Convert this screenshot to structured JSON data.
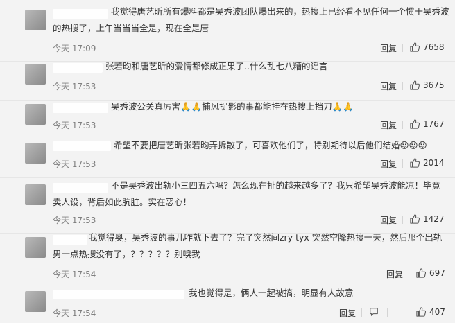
{
  "comments": [
    {
      "text": "我觉得唐艺昕所有爆料都是吴秀波团队爆出来的，热搜上已经看不见任何一个惯于吴秀波的热搜了，上午当当当全是，现在全是唐",
      "time": "今天 17:09",
      "reply": "回复",
      "likes": "7658"
    },
    {
      "text": "张若昀和唐艺昕的爱情都修成正果了..什么乱七八糟的谣言",
      "time": "今天 17:53",
      "reply": "回复",
      "likes": "3675"
    },
    {
      "text": "吴秀波公关真厉害🙏🙏捕风捉影的事都能挂在热搜上挡刀🙏🙏",
      "time": "今天 17:53",
      "reply": "回复",
      "likes": "1767"
    },
    {
      "text": "希望不要把唐艺昕张若昀弄拆散了，可喜欢他们了，特别期待以后他们结婚😟😟😟",
      "time": "今天 17:53",
      "reply": "回复",
      "likes": "2014"
    },
    {
      "text": "不是吴秀波出轨小三四五六吗？怎么现在扯的越来越多了？我只希望吴秀波能凉！毕竟卖人设，背后如此肮脏。实在恶心！",
      "time": "今天 17:53",
      "reply": "回复",
      "likes": "1427"
    },
    {
      "text": "我觉得奥，吴秀波的事儿咋就下去了？完了突然间zry tyx 突然空降热搜一天，然后那个出轨男一点热搜没有了，？？？？？别嗅我",
      "time": "今天 17:54",
      "reply": "回复",
      "likes": "697"
    },
    {
      "text": "我也觉得是，俩人一起被搞，明显有人故意",
      "time": "今天 17:54",
      "reply": "回复",
      "likes": "407"
    }
  ]
}
